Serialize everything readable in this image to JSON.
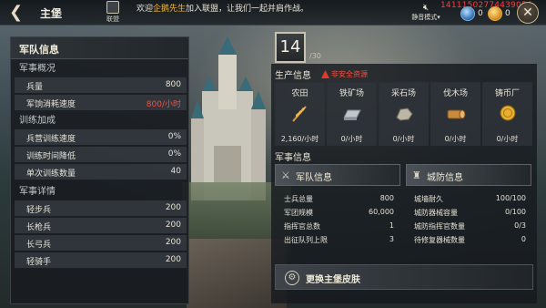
{
  "topbar": {
    "title": "主堡",
    "alliance_label": "联盟",
    "ticker_prefix": "欢迎",
    "ticker_name": "企鹅先生",
    "ticker_suffix": "加入联盟，让我们一起并肩作战。",
    "mute_label": "静音模式",
    "gems": "0",
    "gold": "0",
    "watermark": "14111502774439054"
  },
  "left_panel": {
    "title": "军队信息",
    "overview": {
      "heading": "军事概况",
      "rows": [
        {
          "label": "兵量",
          "value": "800"
        },
        {
          "label": "军饷消耗速度",
          "value": "800/小时"
        }
      ]
    },
    "training": {
      "heading": "训练加成",
      "rows": [
        {
          "label": "兵营训练速度",
          "value": "0%"
        },
        {
          "label": "训练时间降低",
          "value": "0%"
        },
        {
          "label": "单次训练数量",
          "value": "40"
        }
      ]
    },
    "details": {
      "heading": "军事详情",
      "rows": [
        {
          "label": "轻步兵",
          "value": "200"
        },
        {
          "label": "长枪兵",
          "value": "200"
        },
        {
          "label": "长弓兵",
          "value": "200"
        },
        {
          "label": "轻骑手",
          "value": "200"
        }
      ]
    }
  },
  "right_panel": {
    "level": "14",
    "level_max": "/30",
    "production_heading": "生产信息",
    "warning": "非安全资源",
    "resources": [
      {
        "name": "农田",
        "value": "2,160/小时",
        "icon": "wheat-icon"
      },
      {
        "name": "铁矿场",
        "value": "0/小时",
        "icon": "iron-ingot-icon"
      },
      {
        "name": "采石场",
        "value": "0/小时",
        "icon": "stone-icon"
      },
      {
        "name": "伐木场",
        "value": "0/小时",
        "icon": "wood-log-icon"
      },
      {
        "name": "铸币厂",
        "value": "0/小时",
        "icon": "coin-icon"
      }
    ],
    "military_heading": "军事信息",
    "army_tab": "军队信息",
    "defense_tab": "城防信息",
    "army_stats": [
      {
        "label": "士兵总量",
        "value": "800"
      },
      {
        "label": "军团规模",
        "value": "60,000"
      },
      {
        "label": "指挥官总数",
        "value": "1"
      },
      {
        "label": "出征队列上限",
        "value": "3"
      }
    ],
    "defense_stats": [
      {
        "label": "城墙耐久",
        "value": "100/100"
      },
      {
        "label": "城防器械容量",
        "value": "0/100"
      },
      {
        "label": "城防指挥官数量",
        "value": "0/3"
      },
      {
        "label": "待修复器械数量",
        "value": "0"
      }
    ],
    "skin_button": "更换主堡皮肤"
  },
  "colors": {
    "warning_red": "#ff4a3b",
    "highlight_gold": "#f5b83a"
  }
}
